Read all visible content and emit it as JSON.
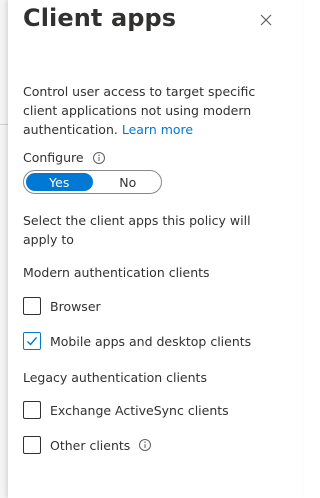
{
  "panel": {
    "title": "Client apps",
    "description": "Control user access to target specific client applications not using modern authentication.",
    "learn_more": "Learn more",
    "configure_label": "Configure",
    "toggle": {
      "yes_label": "Yes",
      "no_label": "No",
      "selected": "Yes"
    },
    "select_prompt": "Select the client apps this policy will apply to",
    "modern_heading": "Modern authentication clients",
    "legacy_heading": "Legacy authentication clients",
    "checkboxes": [
      {
        "label": "Browser",
        "checked": false
      },
      {
        "label": "Mobile apps and desktop clients",
        "checked": true
      },
      {
        "label": "Exchange ActiveSync clients",
        "checked": false
      },
      {
        "label": "Other clients",
        "checked": false
      }
    ]
  },
  "colors": {
    "accent": "#0078d4",
    "text": "#323130"
  },
  "icons": {
    "close": "close-icon",
    "info": "info-icon",
    "check": "checkmark-icon"
  }
}
